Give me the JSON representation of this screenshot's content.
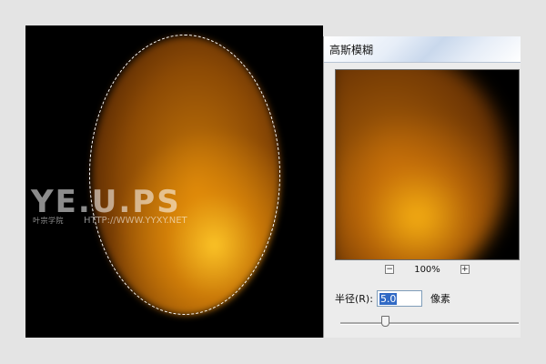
{
  "watermark": {
    "logo": "YE.U.PS",
    "sub": "叶宗学院",
    "url": "HTTP://WWW.YYXY.NET"
  },
  "dialog": {
    "title": "高斯模糊",
    "zoom_out_label": "−",
    "zoom_level": "100%",
    "zoom_in_label": "+",
    "radius_label": "半径(R):",
    "radius_value": "5.0",
    "radius_unit": "像素",
    "radius_slider_fraction": 0.25
  },
  "colors": {
    "canvas_bg": "#000000",
    "dialog_bg": "#ececec",
    "selection_highlight": "#316ac5"
  }
}
